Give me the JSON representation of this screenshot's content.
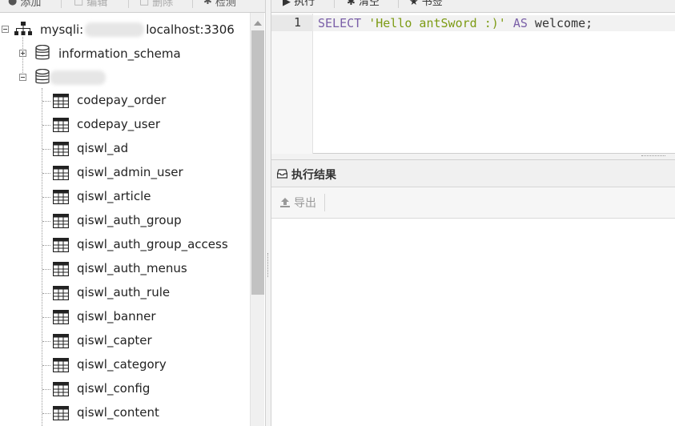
{
  "left_toolbar": {
    "add_label": "添加",
    "edit_label": "编辑",
    "delete_label": "删除",
    "check_label": "检测"
  },
  "right_toolbar": {
    "execute_label": "执行",
    "clear_label": "清空",
    "bookmark_label": "书签"
  },
  "tree": {
    "connection": {
      "prefix": "mysqli:",
      "suffix": "localhost:3306",
      "icon": "sitemap-icon",
      "expanded": true
    },
    "databases": [
      {
        "name": "information_schema",
        "expanded": false,
        "icon": "database-icon"
      },
      {
        "name": "",
        "expanded": true,
        "icon": "database-icon"
      }
    ],
    "tables": [
      "codepay_order",
      "codepay_user",
      "qiswl_ad",
      "qiswl_admin_user",
      "qiswl_article",
      "qiswl_auth_group",
      "qiswl_auth_group_access",
      "qiswl_auth_menus",
      "qiswl_auth_rule",
      "qiswl_banner",
      "qiswl_capter",
      "qiswl_category",
      "qiswl_config",
      "qiswl_content"
    ]
  },
  "editor": {
    "line_number": "1",
    "tokens": [
      {
        "text": "SELECT",
        "kind": "kw"
      },
      {
        "text": " ",
        "kind": "plain"
      },
      {
        "text": "'Hello antSword :)'",
        "kind": "str"
      },
      {
        "text": " ",
        "kind": "plain"
      },
      {
        "text": "AS",
        "kind": "kw"
      },
      {
        "text": " welcome;",
        "kind": "plain"
      }
    ]
  },
  "result": {
    "title": "执行结果",
    "export_label": "导出"
  },
  "colors": {
    "keyword": "#7a5fa8",
    "string": "#7d9b14"
  }
}
